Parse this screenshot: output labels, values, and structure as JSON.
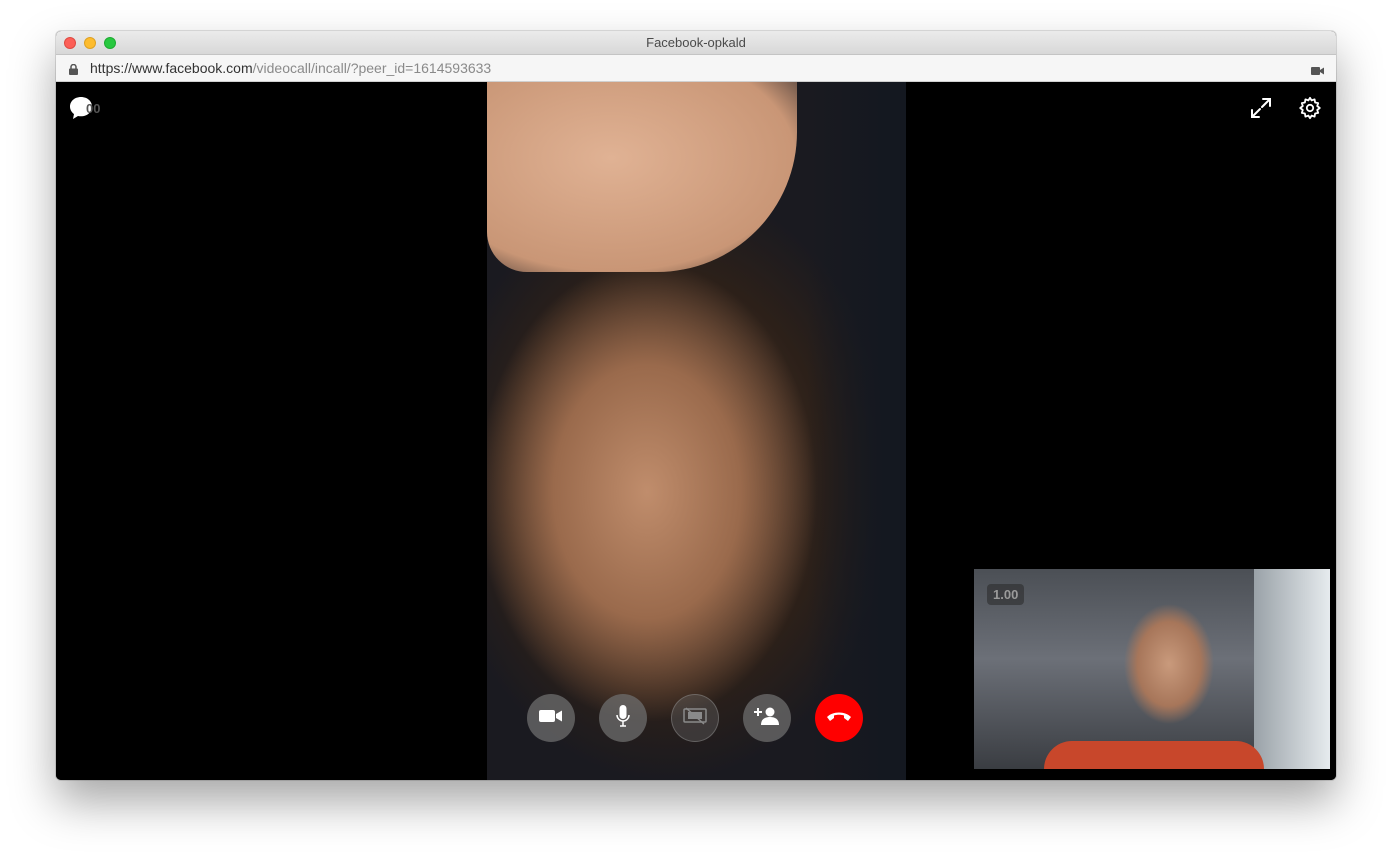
{
  "window": {
    "title": "Facebook-opkald"
  },
  "address_bar": {
    "url_scheme_host": "https://www.facebook.com",
    "url_path": "/videocall/incall/?peer_id=1614593633"
  },
  "call": {
    "chat_overlay_stat": "00",
    "self_view_stat": "1.00",
    "end_call_color": "#ff0000"
  },
  "icons": {
    "chat": "chat-bubble-icon",
    "expand": "fullscreen-icon",
    "settings": "gear-icon",
    "video": "video-camera-icon",
    "mic": "microphone-icon",
    "screen_share": "screen-share-icon",
    "add_person": "add-person-icon",
    "hang_up": "phone-hangup-icon"
  }
}
